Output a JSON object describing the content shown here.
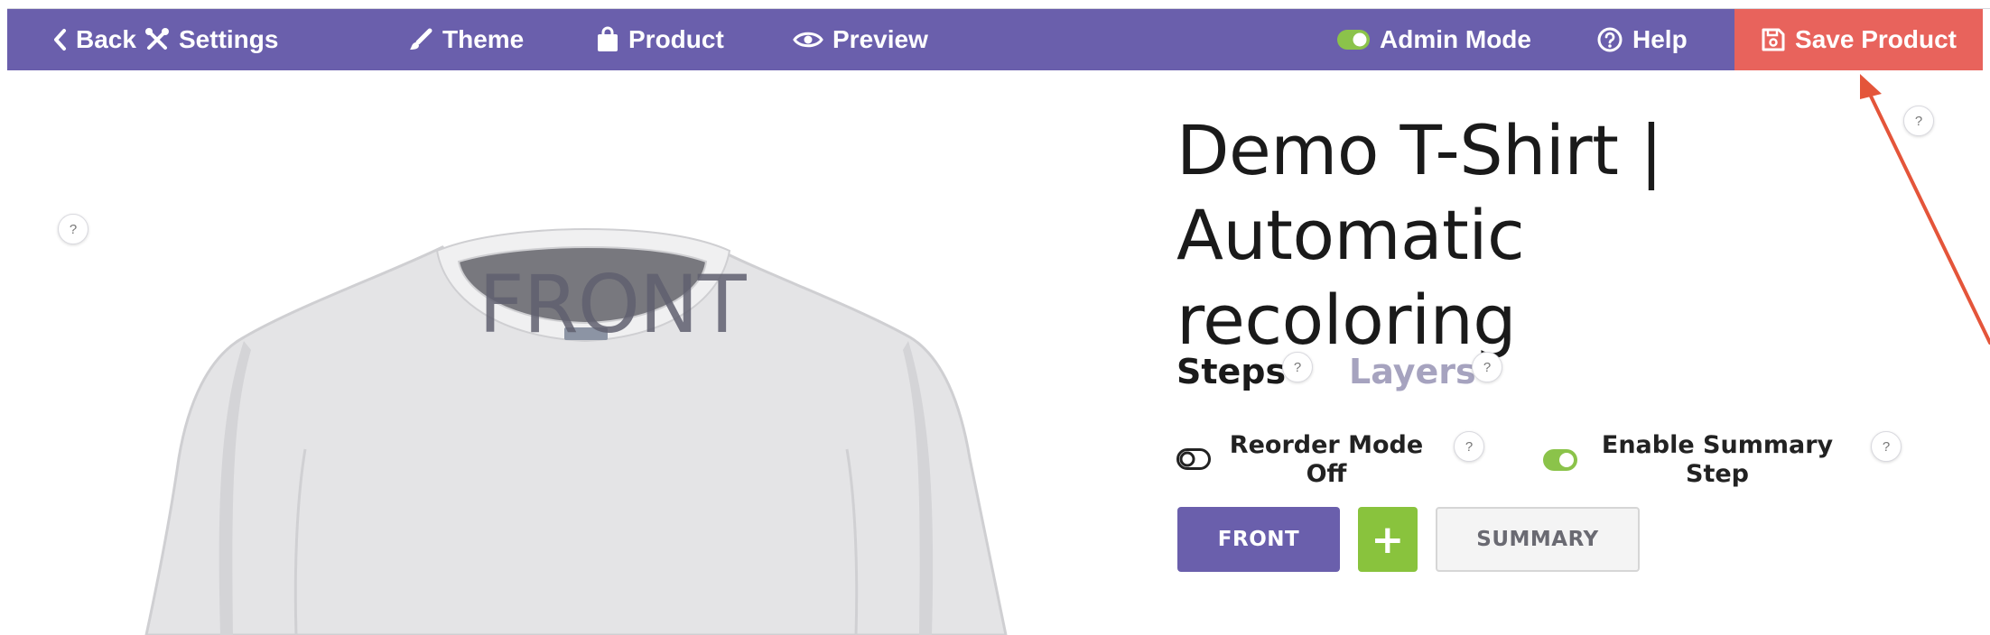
{
  "nav": {
    "back_label": "Back",
    "settings_label": "Settings",
    "theme_label": "Theme",
    "product_label": "Product",
    "preview_label": "Preview",
    "admin_mode_label": "Admin Mode",
    "help_label": "Help",
    "save_label": "Save Product",
    "bar_color": "#6a5fac",
    "save_color": "#e8635c",
    "toggle_on_color": "#8bc34a"
  },
  "canvas": {
    "side_label": "FRONT",
    "help_text": "?"
  },
  "product": {
    "title_line1": "Demo T-Shirt |",
    "title_line2": "Automatic recoloring"
  },
  "tabs": {
    "steps_label": "Steps",
    "layers_label": "Layers"
  },
  "toggles": {
    "reorder_line1": "Reorder Mode",
    "reorder_line2": "Off",
    "summary_line1": "Enable Summary",
    "summary_line2": "Step"
  },
  "steps": {
    "front_label": "FRONT",
    "add_label": "+",
    "summary_label": "SUMMARY"
  },
  "help": {
    "mark": "?"
  },
  "annotation": {
    "arrow_color": "#e4553a"
  }
}
